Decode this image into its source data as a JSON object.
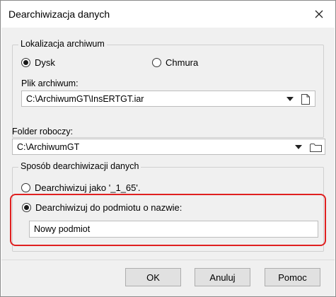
{
  "window": {
    "title": "Dearchiwizacja danych",
    "close_icon": "close-icon"
  },
  "archive_location": {
    "legend": "Lokalizacja archiwum",
    "options": [
      {
        "label": "Dysk",
        "selected": true
      },
      {
        "label": "Chmura",
        "selected": false
      }
    ],
    "file_label": "Plik archiwum:",
    "file_value": "C:\\ArchiwumGT\\InsERTGT.iar"
  },
  "working_folder": {
    "label": "Folder roboczy:",
    "value": "C:\\ArchiwumGT"
  },
  "dearchive_method": {
    "legend": "Sposób dearchiwizacji danych",
    "option_as": {
      "label": "Dearchiwizuj jako '_1_65'.",
      "selected": false
    },
    "option_to_entity": {
      "label": "Dearchiwizuj do podmiotu o nazwie:",
      "selected": true
    },
    "entity_name_value": "Nowy podmiot",
    "highlight_color": "#e02020"
  },
  "buttons": {
    "ok": "OK",
    "cancel": "Anuluj",
    "help": "Pomoc"
  }
}
